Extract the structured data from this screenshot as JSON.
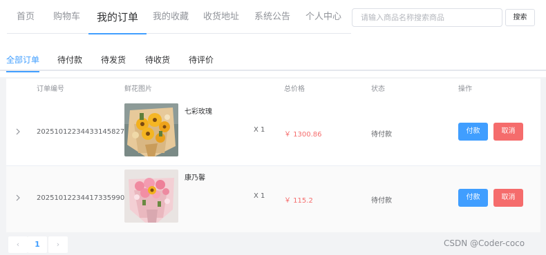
{
  "nav": {
    "items": [
      "首页",
      "购物车",
      "我的订单",
      "我的收藏",
      "收货地址",
      "系统公告",
      "个人中心"
    ],
    "active": "我的订单"
  },
  "search": {
    "placeholder": "请输入商品名称搜索商品",
    "button": "搜索"
  },
  "tabs": {
    "items": [
      "全部订单",
      "待付款",
      "待发货",
      "待收货",
      "待评价"
    ],
    "active": "全部订单"
  },
  "table": {
    "headers": [
      "订单编号",
      "鲜花图片",
      "总价格",
      "状态",
      "操作"
    ],
    "rows": [
      {
        "order_no": "20251012234433145827",
        "flower": "七彩玫瑰",
        "qty": "X 1",
        "price": "￥ 1300.86",
        "status": "待付款",
        "pay": "付款",
        "cancel": "取消"
      },
      {
        "order_no": "20251012234417335990",
        "flower": "康乃馨",
        "qty": "X 1",
        "price": "￥ 115.2",
        "status": "待付款",
        "pay": "付款",
        "cancel": "取消"
      }
    ]
  },
  "pagination": {
    "prev": "‹",
    "current": "1",
    "next": "›"
  },
  "watermark": "CSDN @Coder-coco",
  "colors": {
    "accent": "#409eff",
    "danger": "#f56c6c"
  }
}
